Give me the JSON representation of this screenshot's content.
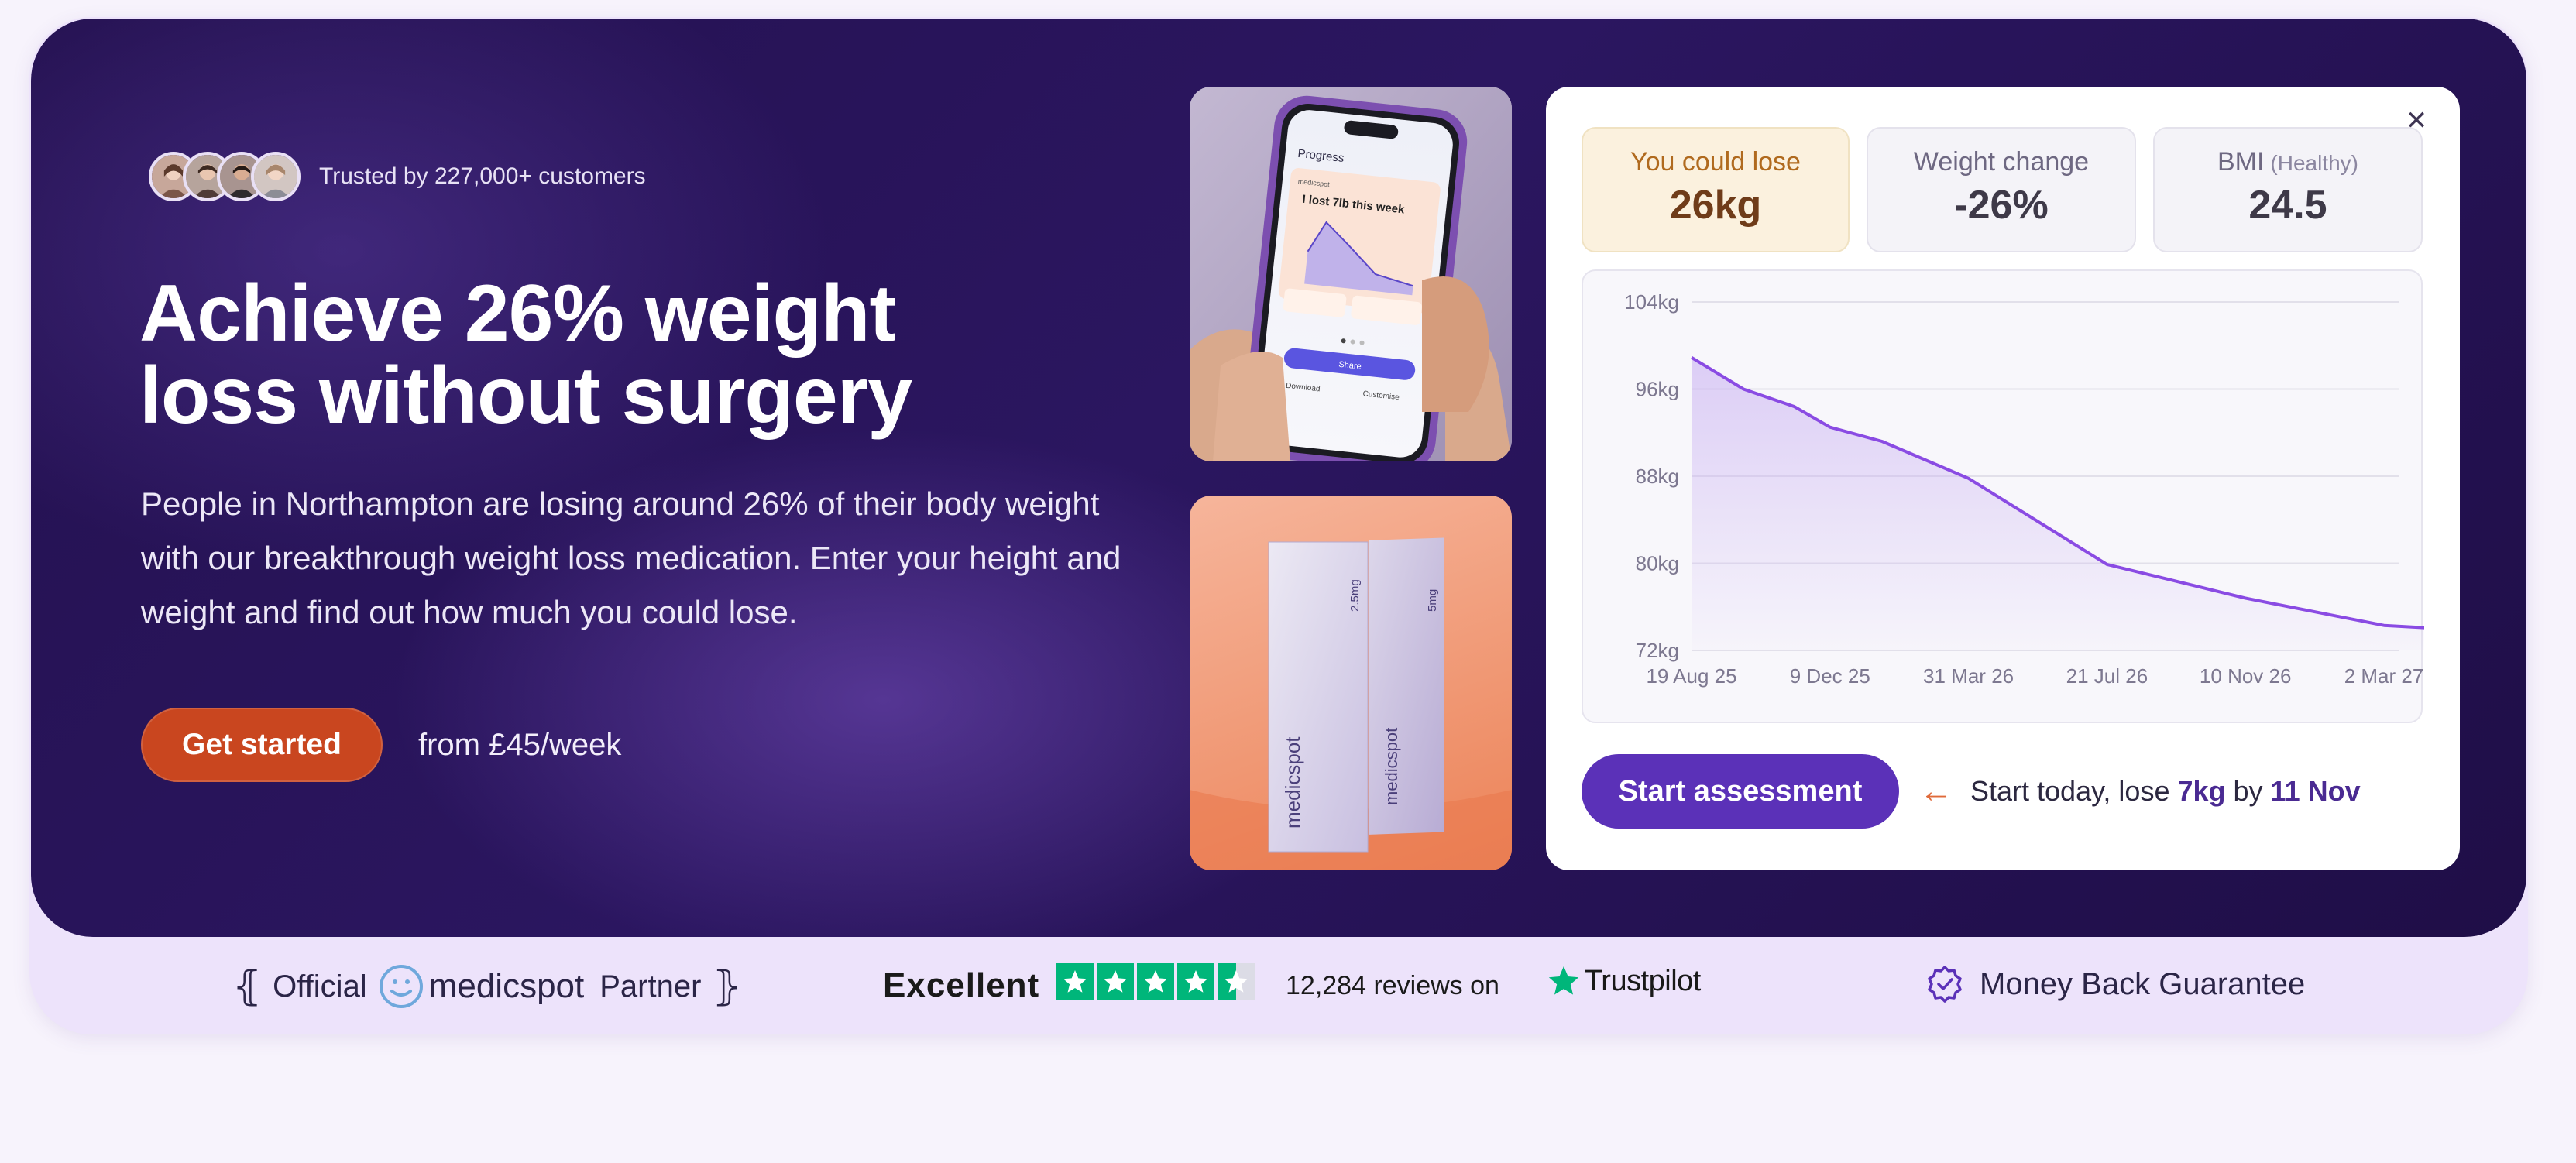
{
  "hero": {
    "trusted_text": "Trusted by 227,000+ customers",
    "headline_line1": "Achieve 26% weight",
    "headline_line2": "loss without surgery",
    "subtext": "People in Northampton are losing around 26% of their body weight with our breakthrough weight loss medication. Enter your height and weight and find out how much you could lose.",
    "cta_label": "Get started",
    "price_text": "from £45/week"
  },
  "phone_mock": {
    "title": "Progress",
    "brand": "medicspot",
    "headline": "I lost 7lb this week",
    "share": "Share",
    "download": "Download",
    "customise": "Customise"
  },
  "product_box": {
    "brand": "medicspot",
    "dose_front": "2.5mg",
    "dose_back": "5mg"
  },
  "calculator": {
    "close_icon": "close-icon",
    "stats": [
      {
        "label": "You could lose",
        "sub": "",
        "value": "26kg"
      },
      {
        "label": "Weight change",
        "sub": "",
        "value": "-26%"
      },
      {
        "label": "BMI",
        "sub": "(Healthy)",
        "value": "24.5"
      }
    ],
    "cta_label": "Start assessment",
    "promise_prefix": "Start today, lose ",
    "promise_amount": "7kg",
    "promise_mid": " by ",
    "promise_date": "11 Nov"
  },
  "chart_data": {
    "type": "area",
    "title": "",
    "xlabel": "",
    "ylabel": "",
    "x_ticks": [
      "19 Aug 25",
      "9 Dec 25",
      "31 Mar 26",
      "21 Jul 26",
      "10 Nov 26",
      "2 Mar 27"
    ],
    "y_ticks": [
      "104kg",
      "96kg",
      "88kg",
      "80kg",
      "72kg"
    ],
    "ylim": [
      72,
      104
    ],
    "grid": true,
    "series": [
      {
        "x": [
          "19 Aug 25",
          "30 Sep 25",
          "10 Nov 25",
          "9 Dec 25",
          "20 Jan 26",
          "31 Mar 26",
          "21 Jul 26",
          "10 Nov 26",
          "2 Mar 27",
          "20 May 27"
        ],
        "values": [
          98.9,
          96.0,
          94.4,
          92.5,
          91.2,
          87.8,
          79.9,
          76.8,
          74.3,
          73.8
        ],
        "color": "#8a4be3"
      }
    ],
    "colors": {
      "line": "#8a4be3",
      "fill": "#c9b1f2"
    }
  },
  "footer": {
    "official": "Official",
    "brand": "medicspot",
    "partner": "Partner",
    "excellent": "Excellent",
    "reviews": "12,284 reviews on",
    "trustpilot": "Trustpilot",
    "money_back": "Money Back Guarantee",
    "star_color": "#00b67a"
  }
}
